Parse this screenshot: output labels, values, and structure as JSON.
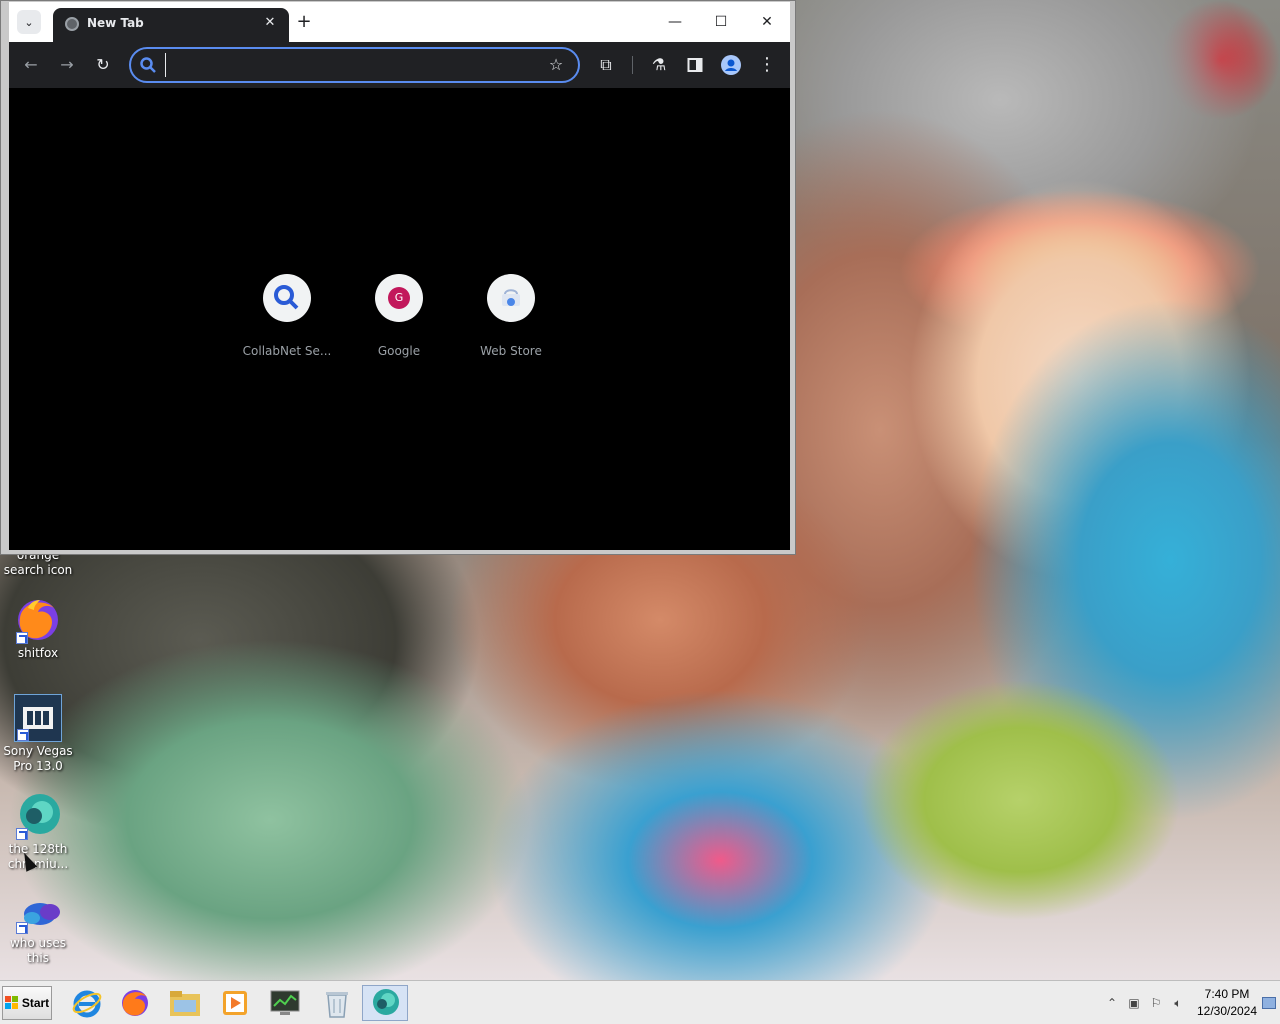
{
  "browser": {
    "tab": {
      "title": "New Tab",
      "close_glyph": "✕"
    },
    "new_tab_glyph": "+",
    "window_controls": {
      "minimize": "—",
      "maximize": "☐",
      "close": "✕"
    },
    "omnibox": {
      "value": "",
      "placeholder": ""
    },
    "shortcuts": [
      {
        "label": "CollabNet Se...",
        "icon": "search-icon"
      },
      {
        "label": "Google",
        "icon": "google-g-icon",
        "badge": "G",
        "badge_color": "#c2185b"
      },
      {
        "label": "Web Store",
        "icon": "web-store-icon"
      }
    ],
    "colors": {
      "tab_bg": "#202124",
      "toolbar_bg": "#202124",
      "omnibox_border": "#5a8cf0",
      "content_bg": "#000000"
    }
  },
  "desktop": {
    "icons": [
      {
        "label": "orange search icon",
        "icon": "orange-search-icon"
      },
      {
        "label": "shitfox",
        "icon": "firefox-icon"
      },
      {
        "label": "Sony Vegas Pro 13.0",
        "icon": "film-icon"
      },
      {
        "label": "the 128th chromiu...",
        "icon": "chromium-icon"
      },
      {
        "label": "who uses this",
        "icon": "edge-icon"
      }
    ]
  },
  "taskbar": {
    "start_label": "Start",
    "apps": [
      {
        "name": "internet-explorer",
        "icon": "ie-icon"
      },
      {
        "name": "firefox",
        "icon": "firefox-icon"
      },
      {
        "name": "file-explorer",
        "icon": "folder-icon"
      },
      {
        "name": "media-player",
        "icon": "media-icon"
      },
      {
        "name": "task-manager",
        "icon": "monitor-icon"
      },
      {
        "name": "recycle-bin",
        "icon": "recycle-bin-icon"
      },
      {
        "name": "chromium",
        "icon": "chromium-icon",
        "active": true
      }
    ],
    "clock": {
      "time": "7:40 PM",
      "date": "12/30/2024"
    }
  }
}
